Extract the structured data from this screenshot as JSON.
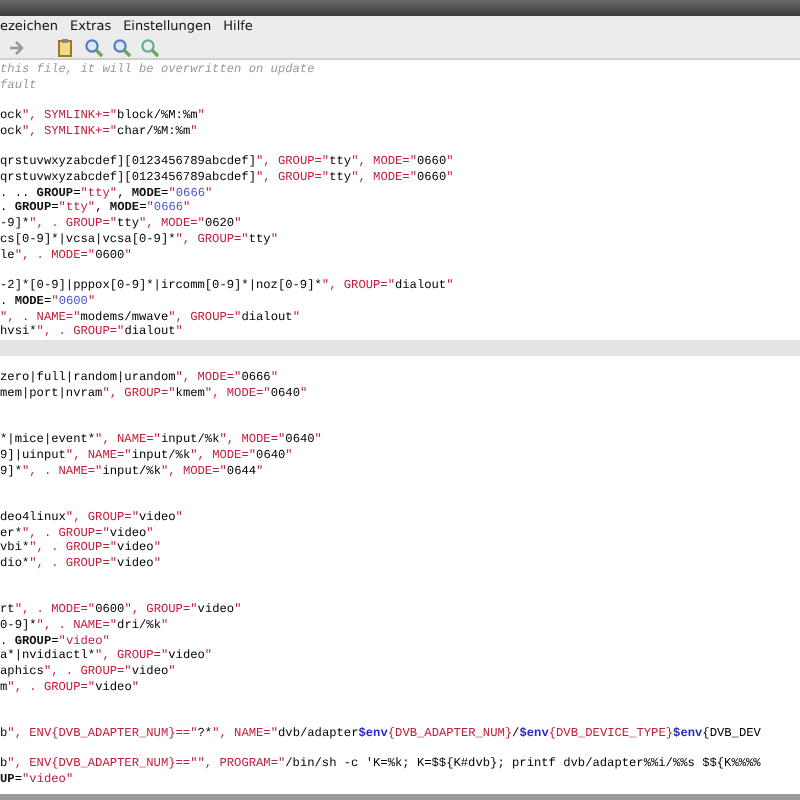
{
  "menu": [
    {
      "label": "ezeichen"
    },
    {
      "label": "Extras"
    },
    {
      "label": "Einstellungen"
    },
    {
      "label": "Hilfe"
    }
  ],
  "toolbar": [
    {
      "kind": "arrow"
    },
    {
      "kind": "clipboard"
    },
    {
      "kind": "find"
    },
    {
      "kind": "find-next"
    },
    {
      "kind": "find-prev"
    }
  ],
  "lines": [
    {
      "kind": "comment",
      "text": "this file, it will be overwritten on update",
      "current": false
    },
    {
      "kind": "comment",
      "text": "fault",
      "current": false
    },
    {
      "kind": "blank",
      "current": false
    },
    {
      "kind": "code",
      "text": "ock\", SYMLINK+=\"block/%M:%m\"",
      "current": false
    },
    {
      "kind": "code",
      "text": "ock\", SYMLINK+=\"char/%M:%m\"",
      "current": false
    },
    {
      "kind": "blank",
      "current": false
    },
    {
      "kind": "code",
      "text": "qrstuvwxyzabcdef][0123456789abcdef]\", GROUP=\"tty\", MODE=\"0660\"",
      "current": false
    },
    {
      "kind": "code",
      "text": "qrstuvwxyzabcdef][0123456789abcdef]\", GROUP=\"tty\", MODE=\"0660\"",
      "current": false
    },
    {
      "kind": "code",
      "text": ". .. GROUP=\"tty\", MODE=\"0666\"",
      "current": false
    },
    {
      "kind": "code",
      "text": ". GROUP=\"tty\", MODE=\"0666\"",
      "current": false
    },
    {
      "kind": "code",
      "text": "-9]*\", . GROUP=\"tty\", MODE=\"0620\"",
      "current": false
    },
    {
      "kind": "code",
      "text": "cs[0-9]*|vcsa|vcsa[0-9]*\", GROUP=\"tty\"",
      "current": false
    },
    {
      "kind": "code",
      "text": "le\", . MODE=\"0600\"",
      "current": false
    },
    {
      "kind": "blank",
      "current": false
    },
    {
      "kind": "code",
      "text": "-2]*[0-9]|pppox[0-9]*|ircomm[0-9]*|noz[0-9]*\", GROUP=\"dialout\"",
      "current": false
    },
    {
      "kind": "code",
      "text": ". MODE=\"0600\"",
      "current": false
    },
    {
      "kind": "code",
      "text": "\", . NAME=\"modems/mwave\", GROUP=\"dialout\"",
      "current": false
    },
    {
      "kind": "code",
      "text": "hvsi*\", . GROUP=\"dialout\"",
      "current": false
    },
    {
      "kind": "blank",
      "current": true
    },
    {
      "kind": "blank",
      "current": false
    },
    {
      "kind": "code",
      "text": "zero|full|random|urandom\", MODE=\"0666\"",
      "current": false
    },
    {
      "kind": "code",
      "text": "mem|port|nvram\", GROUP=\"kmem\", MODE=\"0640\"",
      "current": false
    },
    {
      "kind": "blank",
      "current": false
    },
    {
      "kind": "blank",
      "current": false
    },
    {
      "kind": "code",
      "text": "*|mice|event*\", NAME=\"input/%k\", MODE=\"0640\"",
      "current": false
    },
    {
      "kind": "code",
      "text": "9]|uinput\", NAME=\"input/%k\", MODE=\"0640\"",
      "current": false
    },
    {
      "kind": "code",
      "text": "9]*\", . NAME=\"input/%k\", MODE=\"0644\"",
      "current": false
    },
    {
      "kind": "blank",
      "current": false
    },
    {
      "kind": "blank",
      "current": false
    },
    {
      "kind": "code",
      "text": "deo4linux\", GROUP=\"video\"",
      "current": false
    },
    {
      "kind": "code",
      "text": "er*\", . GROUP=\"video\"",
      "current": false
    },
    {
      "kind": "code",
      "text": "vbi*\", . GROUP=\"video\"",
      "current": false
    },
    {
      "kind": "code",
      "text": "dio*\", . GROUP=\"video\"",
      "current": false
    },
    {
      "kind": "blank",
      "current": false
    },
    {
      "kind": "blank",
      "current": false
    },
    {
      "kind": "code",
      "text": "rt\", . MODE=\"0600\", GROUP=\"video\"",
      "current": false
    },
    {
      "kind": "code",
      "text": "0-9]*\", . NAME=\"dri/%k\"",
      "current": false
    },
    {
      "kind": "code",
      "text": ". GROUP=\"video\"",
      "current": false
    },
    {
      "kind": "code",
      "text": "a*|nvidiactl*\", GROUP=\"video\"",
      "current": false
    },
    {
      "kind": "code",
      "text": "aphics\", . GROUP=\"video\"",
      "current": false
    },
    {
      "kind": "code",
      "text": "m\", . GROUP=\"video\"",
      "current": false
    },
    {
      "kind": "blank",
      "current": false
    },
    {
      "kind": "blank",
      "current": false
    },
    {
      "kind": "code",
      "text": "b\", ENV{DVB_ADAPTER_NUM}==\"?*\", NAME=\"dvb/adapter$env{DVB_ADAPTER_NUM}/$env{DVB_DEVICE_TYPE}$env{DVB_DEV",
      "current": false
    },
    {
      "kind": "blank",
      "current": false
    },
    {
      "kind": "code",
      "text": "b\", ENV{DVB_ADAPTER_NUM}==\"\", PROGRAM=\"/bin/sh -c 'K=%k; K=$${K#dvb}; printf dvb/adapter%%i/%%s $${K%%%%",
      "current": false
    },
    {
      "kind": "code",
      "text": "UP=\"video\"",
      "current": false
    }
  ]
}
